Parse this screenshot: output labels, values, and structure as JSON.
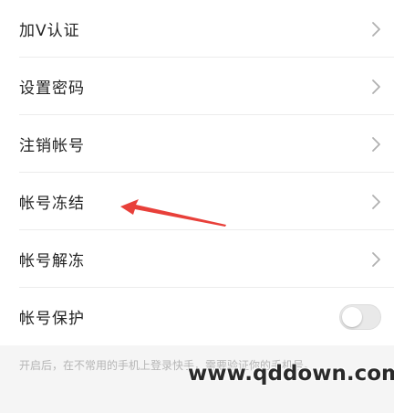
{
  "settings": {
    "items": [
      {
        "label": "加V认证",
        "control": "chevron-right-icon"
      },
      {
        "label": "设置密码",
        "control": "chevron-right-icon"
      },
      {
        "label": "注销帐号",
        "control": "chevron-right-icon"
      },
      {
        "label": "帐号冻结",
        "control": "chevron-right-icon"
      },
      {
        "label": "帐号解冻",
        "control": "chevron-right-icon"
      },
      {
        "label": "帐号保护",
        "control": "toggle",
        "toggle_on": false
      }
    ],
    "protection_hint": "开启后，在不常用的手机上登录快手，需要验证你的手机号。"
  },
  "overlay": {
    "watermark": "www.qddown.com",
    "arrow_color": "#e8403a"
  }
}
